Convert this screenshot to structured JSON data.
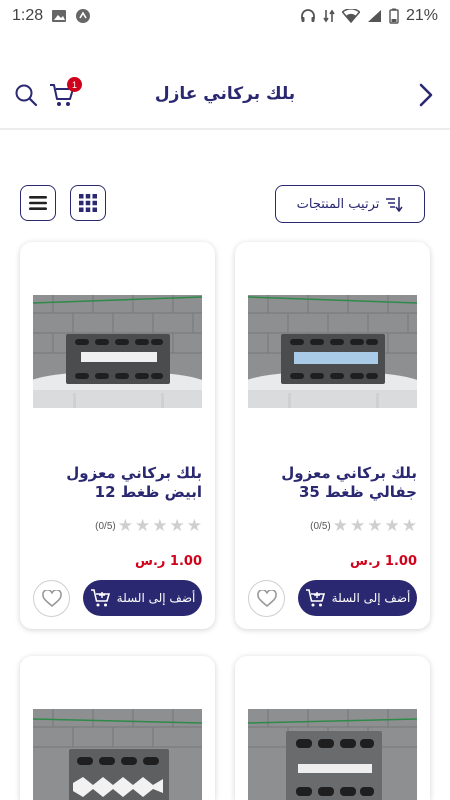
{
  "status_bar": {
    "time": "1:28",
    "battery": "21%"
  },
  "header": {
    "title": "بلك بركاني عازل",
    "cart_count": "1"
  },
  "toolbar": {
    "sort_label": "ترتيب المنتجات"
  },
  "products": [
    {
      "name": "بلك بركاني معزول جفالي ظغط 35",
      "rating_text": "(0/5)",
      "price": "1.00 ر.س",
      "add_label": "أضف إلى السلة",
      "insulation_color": "#a9cbe8"
    },
    {
      "name": "بلك بركاني معزول ابيض ظغط 12",
      "rating_text": "(0/5)",
      "price": "1.00 ر.س",
      "add_label": "أضف إلى السلة",
      "insulation_color": "#f0f0f0"
    }
  ],
  "icons": [
    "back-arrow-icon",
    "search-icon",
    "cart-icon",
    "grid-view-icon",
    "list-view-icon",
    "sort-icon",
    "star-icon",
    "add-to-cart-icon",
    "heart-icon"
  ]
}
